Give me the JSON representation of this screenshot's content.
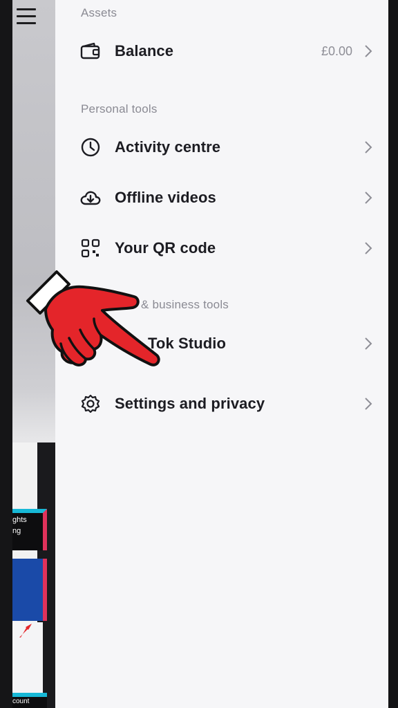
{
  "drawer": {
    "sections": {
      "assets": "Assets",
      "personal_tools": "Personal tools",
      "business_tools": "& business tools"
    },
    "items": {
      "balance": {
        "label": "Balance",
        "value": "£0.00",
        "icon": "wallet-icon"
      },
      "activity": {
        "label": "Activity centre",
        "icon": "clock-icon"
      },
      "offline": {
        "label": "Offline videos",
        "icon": "cloud-download-icon"
      },
      "qr": {
        "label": "Your QR code",
        "icon": "qr-code-icon"
      },
      "studio": {
        "label": "Tok Studio",
        "icon": "studio-icon"
      },
      "settings": {
        "label": "Settings and privacy",
        "icon": "gear-icon"
      }
    }
  },
  "background": {
    "thumb_text_1": "ghts",
    "thumb_text_2": "ng",
    "thumb_text_3": "count"
  },
  "colors": {
    "drawer_bg": "#f6f6f8",
    "text_primary": "#1c1c22",
    "text_secondary": "#8a8a93",
    "hand_red": "#e4252a"
  }
}
